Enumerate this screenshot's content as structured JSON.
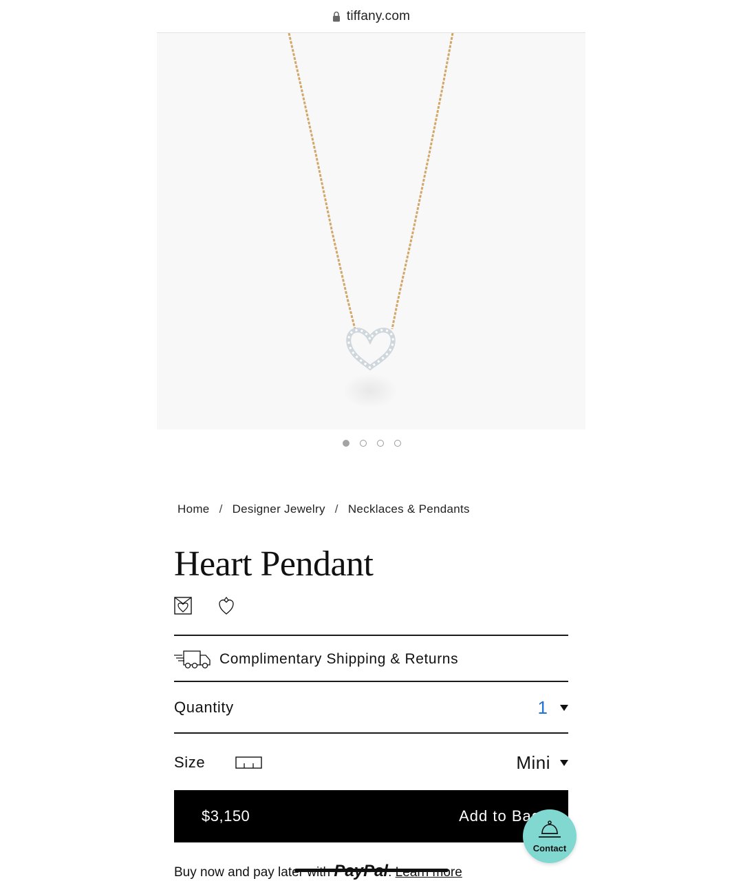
{
  "browser": {
    "url": "tiffany.com"
  },
  "carousel": {
    "count": 4,
    "active_index": 0
  },
  "breadcrumb": {
    "items": [
      "Home",
      "Designer Jewelry",
      "Necklaces & Pendants"
    ],
    "separator": "/"
  },
  "product": {
    "title": "Heart Pendant",
    "shipping_label": "Complimentary Shipping & Returns",
    "quantity_label": "Quantity",
    "quantity_value": "1",
    "size_label": "Size",
    "size_value": "Mini",
    "price": "$3,150",
    "add_to_bag": "Add to Bag"
  },
  "contact": {
    "label": "Contact"
  },
  "paypal": {
    "prefix": "Buy now and pay later with",
    "brand": "PayPal",
    "suffix": ".",
    "link": "Learn more"
  },
  "colors": {
    "accent_blue": "#1e73d6",
    "tiffany_blue": "#81d8d0",
    "gold_chain": "#d2a86a",
    "bar_black": "#000000"
  }
}
